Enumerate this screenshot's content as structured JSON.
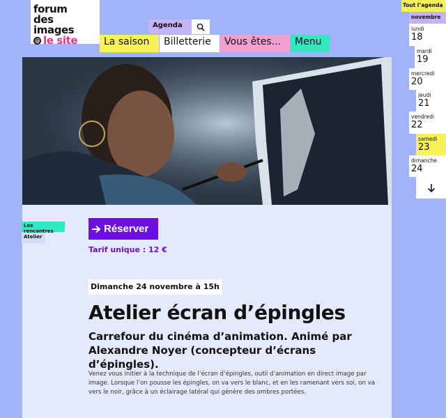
{
  "logo": {
    "line1": "forum",
    "line2": "des images",
    "line3": "le site",
    "at": "@"
  },
  "nav": {
    "agenda": "Agenda",
    "items": [
      "La saison",
      "Billetterie",
      "Vous êtes...",
      "Menu"
    ]
  },
  "tags": [
    "Les rencontres",
    "Atelier"
  ],
  "reserve_label": "Réserver",
  "tarif": "Tarif unique : 12 €",
  "date": "Dimanche 24 novembre à 15h",
  "title": "Atelier écran d’épingles",
  "subtitle": "Carrefour du cinéma d’animation. Animé par Alexandre Noyer (concepteur d’écrans d’épingles).",
  "description": "Venez vous initier à la technique de l’écran d’épingles, outil d’animation en direct image par image. Lorsque l’on pousse les épingles, on va vers le blanc, et en les ramenant vers soi, on va vers le noir, grâce à un éclairage latéral qui génère des ombres portées.",
  "agenda_panel": {
    "all_label": "Tout l’agenda",
    "month": "novembre",
    "days": [
      {
        "name": "lundi",
        "num": "18"
      },
      {
        "name": "mardi",
        "num": "19"
      },
      {
        "name": "mercredi",
        "num": "20"
      },
      {
        "name": "jeudi",
        "num": "21"
      },
      {
        "name": "vendredi",
        "num": "22"
      },
      {
        "name": "samedi",
        "num": "23"
      },
      {
        "name": "dimanche",
        "num": "24"
      }
    ]
  },
  "colors": {
    "background": "#a3b3f7",
    "purple": "#6b0fe3",
    "yellow": "#f7f25a",
    "pink": "#f29ed0",
    "teal": "#34e7c0",
    "lavender": "#c5b4f4",
    "logo_pink": "#e8358e"
  },
  "icons": {
    "search": "search-icon",
    "down": "arrow-down-icon",
    "reserve": "arrow-right-icon"
  }
}
